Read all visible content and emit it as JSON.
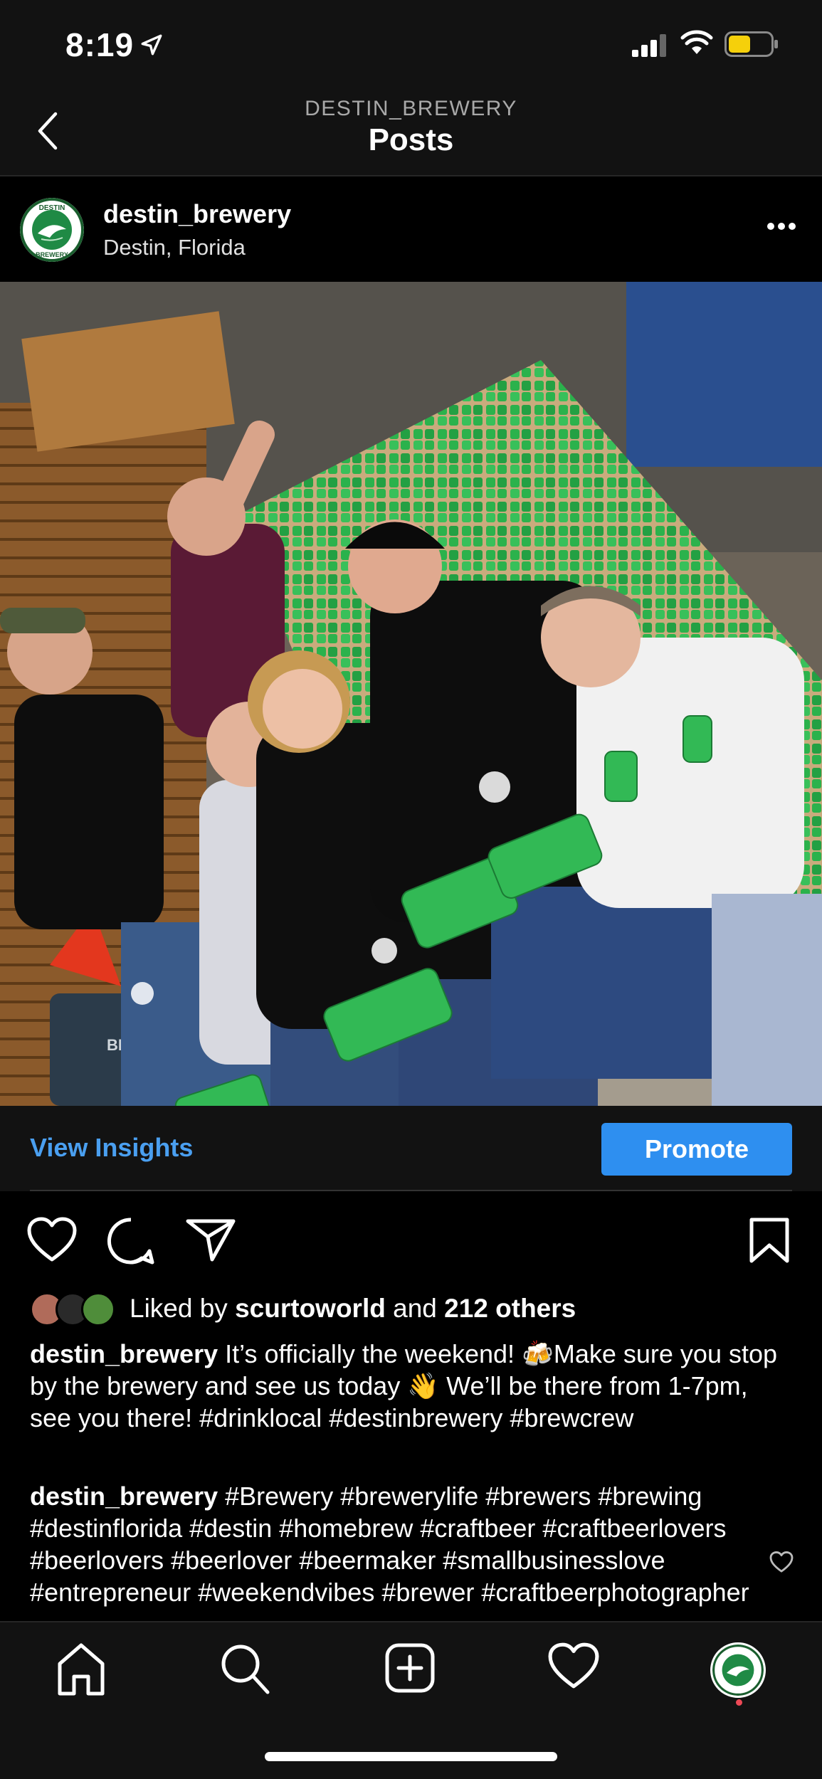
{
  "status_bar": {
    "time": "8:19"
  },
  "nav": {
    "subtitle": "DESTIN_BREWERY",
    "title": "Posts"
  },
  "post": {
    "username": "destin_brewery",
    "location": "Destin, Florida",
    "avatar_text_top": "DESTIN",
    "avatar_text_bottom": "BREWERY",
    "cooler_label": "BRUTE"
  },
  "insights": {
    "view_label": "View Insights",
    "promote_label": "Promote"
  },
  "likes": {
    "prefix": "Liked by",
    "user": "scurtoworld",
    "middle": "and",
    "others": "212 others"
  },
  "caption": {
    "username": "destin_brewery",
    "text": "It’s officially the weekend! 🍻Make sure you stop by the brewery and see us today 👋 We’ll be there from 1-7pm, see you there! #drinklocal #destinbrewery #brewcrew"
  },
  "comment": {
    "username": "destin_brewery",
    "text": "#Brewery #brewerylife #brewers #brewing #destinflorida #destin #homebrew #craftbeer #craftbeerlovers #beerlovers #beerlover #beermaker #smallbusinesslove #entrepreneur #weekendvibes #brewer #craftbeerphotographer"
  },
  "colors": {
    "accent": "#2e8ff0",
    "link": "#4a9ff0",
    "background": "#000000",
    "bar": "#121212",
    "can_green": "#2bb24c"
  }
}
